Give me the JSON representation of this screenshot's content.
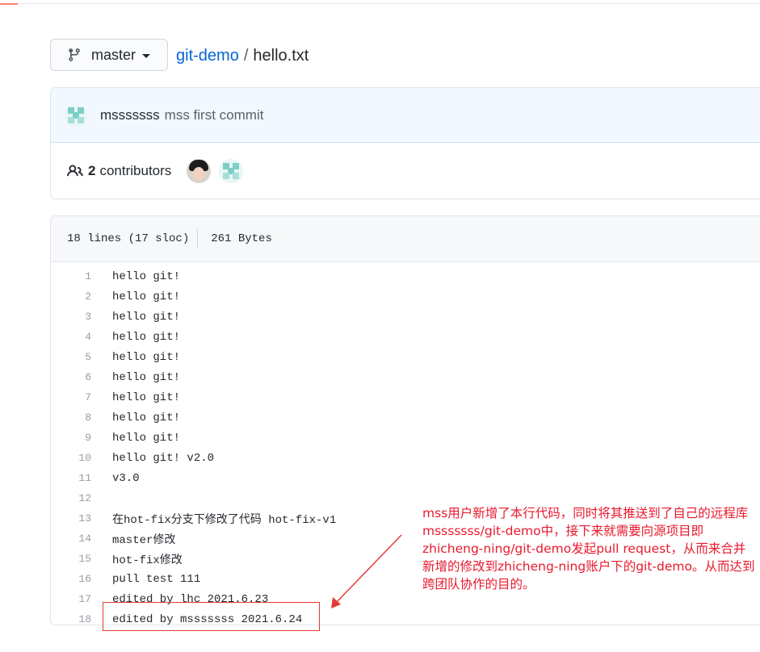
{
  "branch": {
    "label": "master",
    "icon": "branch-icon"
  },
  "breadcrumb": {
    "repo": "git-demo",
    "separator": "/",
    "file": "hello.txt"
  },
  "commit": {
    "author": "msssssss",
    "message": "mss first commit",
    "avatar": "identicon-avatar"
  },
  "contributors": {
    "icon": "people-icon",
    "count": "2",
    "label": "contributors"
  },
  "file_info": {
    "lines": "18 lines (17 sloc)",
    "size": "261 Bytes"
  },
  "code_lines": [
    {
      "num": "1",
      "text": "hello git!"
    },
    {
      "num": "2",
      "text": "hello git!"
    },
    {
      "num": "3",
      "text": "hello git!"
    },
    {
      "num": "4",
      "text": "hello git!"
    },
    {
      "num": "5",
      "text": "hello git!"
    },
    {
      "num": "6",
      "text": "hello git!"
    },
    {
      "num": "7",
      "text": "hello git!"
    },
    {
      "num": "8",
      "text": "hello git!"
    },
    {
      "num": "9",
      "text": "hello git!"
    },
    {
      "num": "10",
      "text": "hello git! v2.0"
    },
    {
      "num": "11",
      "text": "v3.0"
    },
    {
      "num": "12",
      "text": ""
    },
    {
      "num": "13",
      "text": "在hot-fix分支下修改了代码 hot-fix-v1"
    },
    {
      "num": "14",
      "text": "master修改"
    },
    {
      "num": "15",
      "text": "hot-fix修改"
    },
    {
      "num": "16",
      "text": "pull test 111"
    },
    {
      "num": "17",
      "text": "edited by lhc 2021.6.23"
    },
    {
      "num": "18",
      "text": "edited by msssssss 2021.6.24"
    }
  ],
  "annotation": {
    "text": "mss用户新增了本行代码，同时将其推送到了自己的远程库msssssss/git-demo中，接下来就需要向源项目即zhicheng-ning/git-demo发起pull request，从而来合并新增的修改到zhicheng-ning账户下的git-demo。从而达到跨团队协作的目的。",
    "color": "#e8192c"
  },
  "colors": {
    "link": "#0366d6",
    "commit_bg": "#f1f8ff",
    "highlight": "#e53935"
  }
}
